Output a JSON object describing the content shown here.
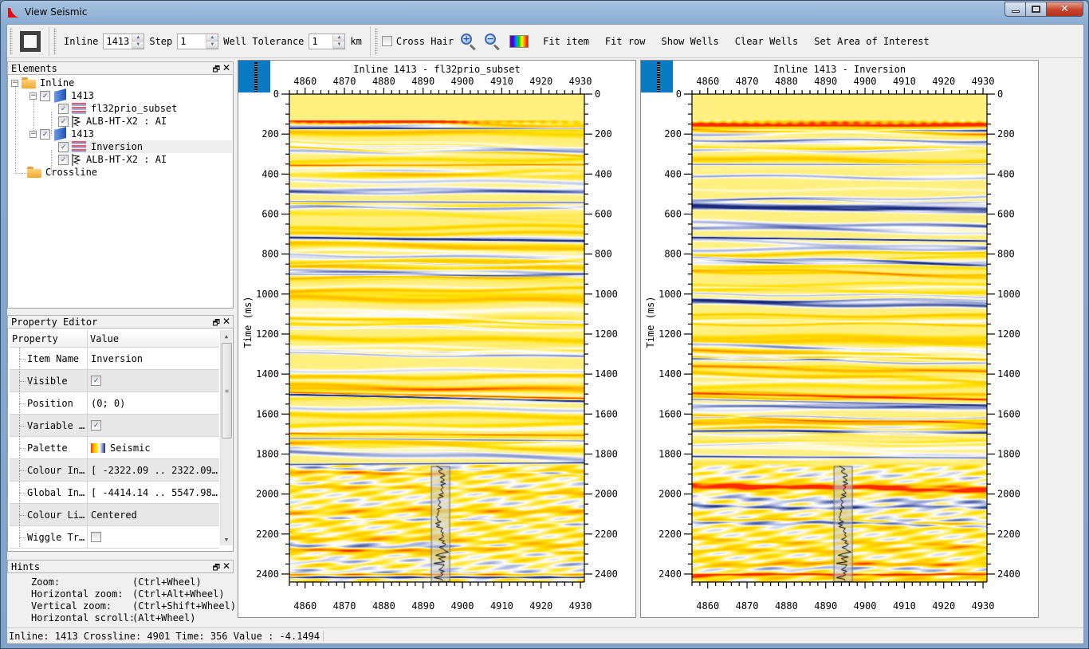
{
  "window": {
    "title": "View Seismic",
    "controls": [
      "minimize",
      "maximize",
      "close"
    ]
  },
  "toolbar": {
    "inline_label": "Inline",
    "inline_value": "1413",
    "step_label": "Step",
    "step_value": "1",
    "well_tolerance_label": "Well Tolerance",
    "well_tolerance_value": "1",
    "well_tolerance_unit": "km",
    "cross_hair_label": "Cross Hair",
    "cross_hair_checked": false,
    "fit_item": "Fit item",
    "fit_row": "Fit row",
    "show_wells": "Show Wells",
    "clear_wells": "Clear Wells",
    "set_aoi": "Set Area of Interest"
  },
  "elements_dock": {
    "title": "Elements",
    "tree": [
      {
        "label": "Inline",
        "type": "folder",
        "level": 0
      },
      {
        "label": "1413",
        "type": "section",
        "level": 1,
        "checked": true
      },
      {
        "label": "fl32prio_subset",
        "type": "seismic",
        "level": 2,
        "checked": true
      },
      {
        "label": "ALB-HT-X2 : AI",
        "type": "well",
        "level": 2,
        "checked": true
      },
      {
        "label": "1413",
        "type": "section",
        "level": 1,
        "checked": true
      },
      {
        "label": "Inversion",
        "type": "seismic",
        "level": 2,
        "checked": true,
        "selected": true
      },
      {
        "label": "ALB-HT-X2 : AI",
        "type": "well",
        "level": 2,
        "checked": true
      },
      {
        "label": "Crossline",
        "type": "folder",
        "level": 0
      }
    ]
  },
  "property_editor": {
    "title": "Property Editor",
    "col_property": "Property",
    "col_value": "Value",
    "rows": [
      {
        "name": "Item Name",
        "value": "Inversion",
        "kind": "text"
      },
      {
        "name": "Visible",
        "value": "true",
        "kind": "check"
      },
      {
        "name": "Position",
        "value": "(0; 0)",
        "kind": "text"
      },
      {
        "name": "Variable …",
        "value": "true",
        "kind": "check"
      },
      {
        "name": "Palette",
        "value": "Seismic",
        "kind": "palette"
      },
      {
        "name": "Colour In…",
        "value": "[ -2322.09 .. 2322.09…",
        "kind": "text"
      },
      {
        "name": "Global In…",
        "value": "[ -4414.14 .. 5547.98…",
        "kind": "text"
      },
      {
        "name": "Colour Li…",
        "value": "Centered",
        "kind": "text"
      },
      {
        "name": "Wiggle Tr…",
        "value": "false",
        "kind": "check"
      }
    ]
  },
  "hints_dock": {
    "title": "Hints",
    "lines": [
      {
        "action": "Zoom:",
        "keys": "(Ctrl+Wheel)"
      },
      {
        "action": "Horizontal zoom:",
        "keys": "(Ctrl+Alt+Wheel)"
      },
      {
        "action": "Vertical zoom:",
        "keys": "(Ctrl+Shift+Wheel)"
      },
      {
        "action": "Horizontal scroll:",
        "keys": "(Alt+Wheel)"
      }
    ]
  },
  "status": {
    "text": "Inline: 1413 Crossline: 4901 Time: 356 Value : -4.1494"
  },
  "viewers": [
    {
      "title": "Inline 1413 - fl32prio_subset",
      "x_ticks": [
        4860,
        4870,
        4880,
        4890,
        4900,
        4910,
        4920,
        4930
      ],
      "x_range": [
        4856,
        4931
      ],
      "y_label": "Time (ms)",
      "y_ticks": [
        0,
        200,
        400,
        600,
        800,
        1000,
        1200,
        1400,
        1600,
        1800,
        2000,
        2200,
        2400
      ],
      "y_range": [
        0,
        2440
      ],
      "well_crossline": 4892,
      "well_name": "ALB-HT-X2 : AI",
      "variant": "seismic"
    },
    {
      "title": "Inline 1413 - Inversion",
      "x_ticks": [
        4860,
        4870,
        4880,
        4890,
        4900,
        4910,
        4920,
        4930
      ],
      "x_range": [
        4856,
        4931
      ],
      "y_label": "Time (ms)",
      "y_ticks": [
        0,
        200,
        400,
        600,
        800,
        1000,
        1200,
        1400,
        1600,
        1800,
        2000,
        2200,
        2400
      ],
      "y_range": [
        0,
        2440
      ],
      "well_crossline": 4892,
      "well_name": "ALB-HT-X2 : AI",
      "variant": "inversion"
    }
  ],
  "colors": {
    "palette_seismic": [
      "#1b2a7a",
      "#8b9ad0",
      "#ffffff",
      "#ffe000",
      "#ffb000",
      "#ff2a00"
    ],
    "corner_accent": "#0a7ac4"
  }
}
